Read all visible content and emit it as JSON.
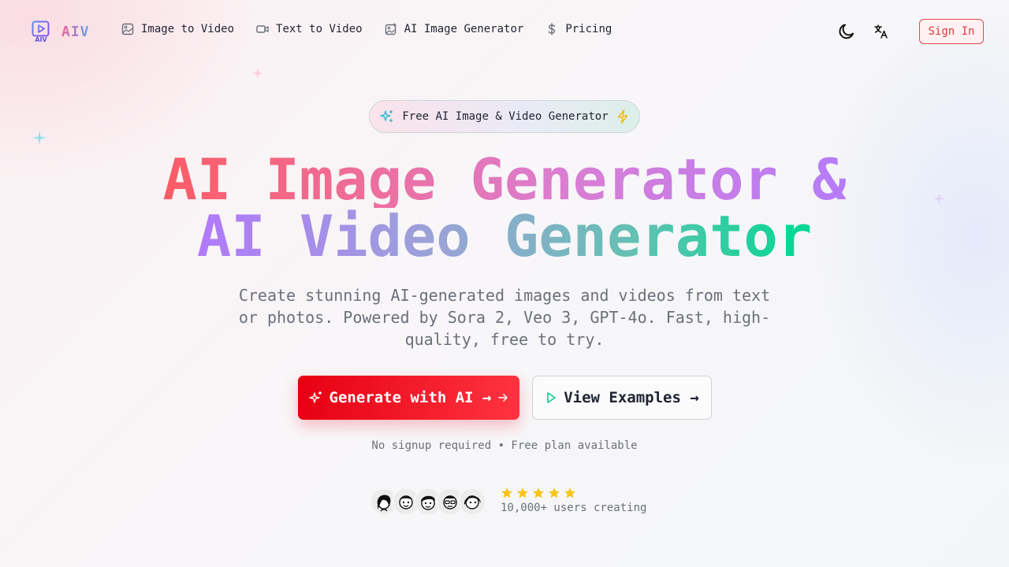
{
  "brand": {
    "name": "AIV",
    "mark_label": "AIV"
  },
  "nav": {
    "items": [
      {
        "label": "Image to Video",
        "icon": "image-icon"
      },
      {
        "label": "Text to Video",
        "icon": "video-camera-icon"
      },
      {
        "label": "AI Image Generator",
        "icon": "image-sparkle-icon"
      },
      {
        "label": "Pricing",
        "icon": "dollar-icon"
      }
    ],
    "theme_toggle_icon": "moon-icon",
    "language_icon": "translate-icon",
    "signin_label": "Sign In"
  },
  "hero": {
    "badge": "Free AI Image & Video Generator",
    "headline_line1": "AI Image Generator &",
    "headline_line2": "AI Video Generator",
    "subtitle": "Create stunning AI-generated images and videos from text or photos. Powered by Sora 2, Veo 3, GPT-4o. Fast, high-quality, free to try.",
    "primary_button": "Generate with AI →",
    "secondary_button": "View Examples →",
    "note": "No signup required • Free plan available"
  },
  "social_proof": {
    "stars": 5,
    "users_text": "10,000+ users creating"
  },
  "colors": {
    "accent_red": "#e60012",
    "star": "#f5c518",
    "gradient_start": "#fb5c66",
    "gradient_end": "#00d991"
  }
}
